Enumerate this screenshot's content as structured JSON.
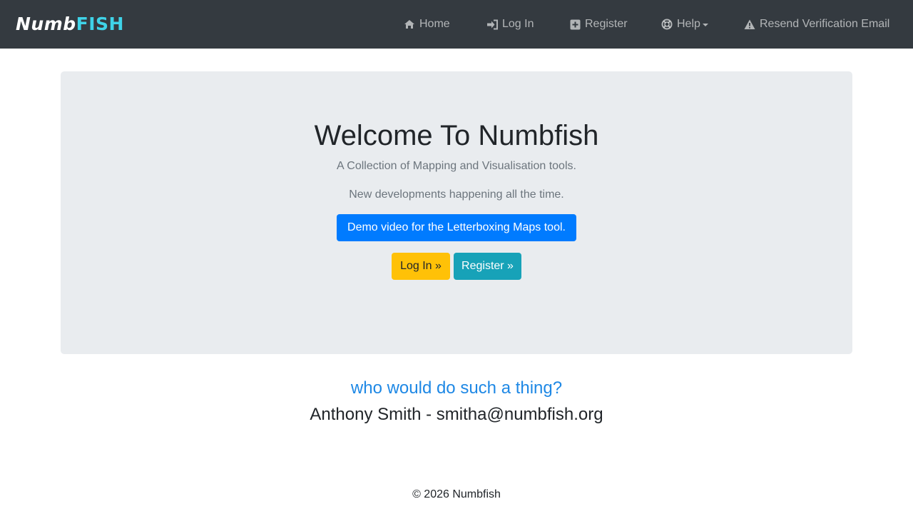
{
  "brand": {
    "part1": "Numb",
    "part2": "FISH"
  },
  "nav": {
    "home": {
      "label": "Home",
      "icon": "home-icon"
    },
    "login": {
      "label": "Log In",
      "icon": "sign-in-icon"
    },
    "register": {
      "label": "Register",
      "icon": "plus-square-icon"
    },
    "help": {
      "label": "Help",
      "icon": "life-ring-icon"
    },
    "resend": {
      "label": "Resend Verification Email",
      "icon": "warning-icon"
    }
  },
  "jumbotron": {
    "title": "Welcome To Numbfish",
    "lead1": "A Collection of Mapping and Visualisation tools.",
    "lead2": "New developments happening all the time.",
    "demo_button": "Demo video for the Letterboxing Maps tool.",
    "login_button": "Log In »",
    "register_button": "Register »"
  },
  "about": {
    "question": "who would do such a thing?",
    "contact": "Anthony Smith - smitha@numbfish.org"
  },
  "footer": {
    "copyright": "© 2026 Numbfish"
  },
  "colors": {
    "navbar": "#343a40",
    "brand_accent": "#3fd3e8",
    "jumbotron": "#e9ecef",
    "primary": "#007bff",
    "warning": "#ffc107",
    "info": "#17a2b8",
    "question": "#1e88e5"
  }
}
